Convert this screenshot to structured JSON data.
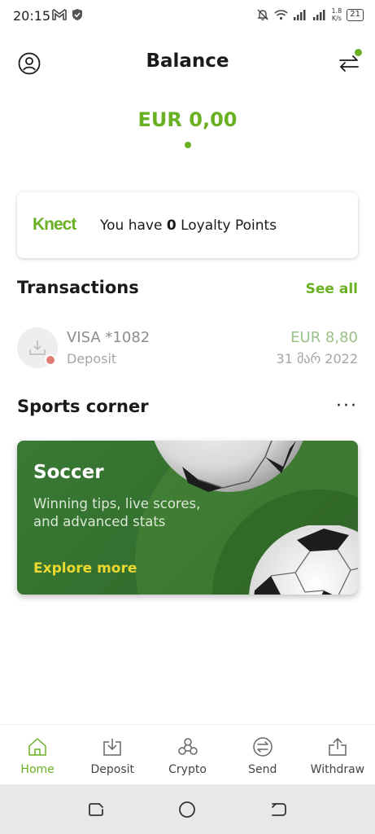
{
  "status_bar": {
    "time": "20:15",
    "speed_value": "1.8",
    "speed_unit": "K/s",
    "battery": "21"
  },
  "header": {
    "title": "Balance"
  },
  "balance": {
    "amount": "EUR 0,00"
  },
  "loyalty": {
    "logo_text": "Knect",
    "text_prefix": "You have ",
    "points": "0",
    "text_suffix": " Loyalty Points"
  },
  "transactions": {
    "title": "Transactions",
    "see_all_label": "See all",
    "items": [
      {
        "title": "VISA *1082",
        "type": "Deposit",
        "amount": "EUR 8,80",
        "date": "31 მარ 2022"
      }
    ]
  },
  "sports": {
    "title": "Sports corner",
    "more_label": "···",
    "card": {
      "title": "Soccer",
      "description": "Winning tips, live scores, and advanced stats",
      "cta": "Explore more"
    }
  },
  "bottom_nav": {
    "items": [
      {
        "label": "Home",
        "icon": "home-icon"
      },
      {
        "label": "Deposit",
        "icon": "deposit-icon"
      },
      {
        "label": "Crypto",
        "icon": "crypto-icon"
      },
      {
        "label": "Send",
        "icon": "send-icon"
      },
      {
        "label": "Withdraw",
        "icon": "withdraw-icon"
      }
    ]
  },
  "colors": {
    "accent": "#6ab023",
    "card_green": "#34702f",
    "cta_yellow": "#ecd930",
    "pending_dot": "#e07a74"
  }
}
